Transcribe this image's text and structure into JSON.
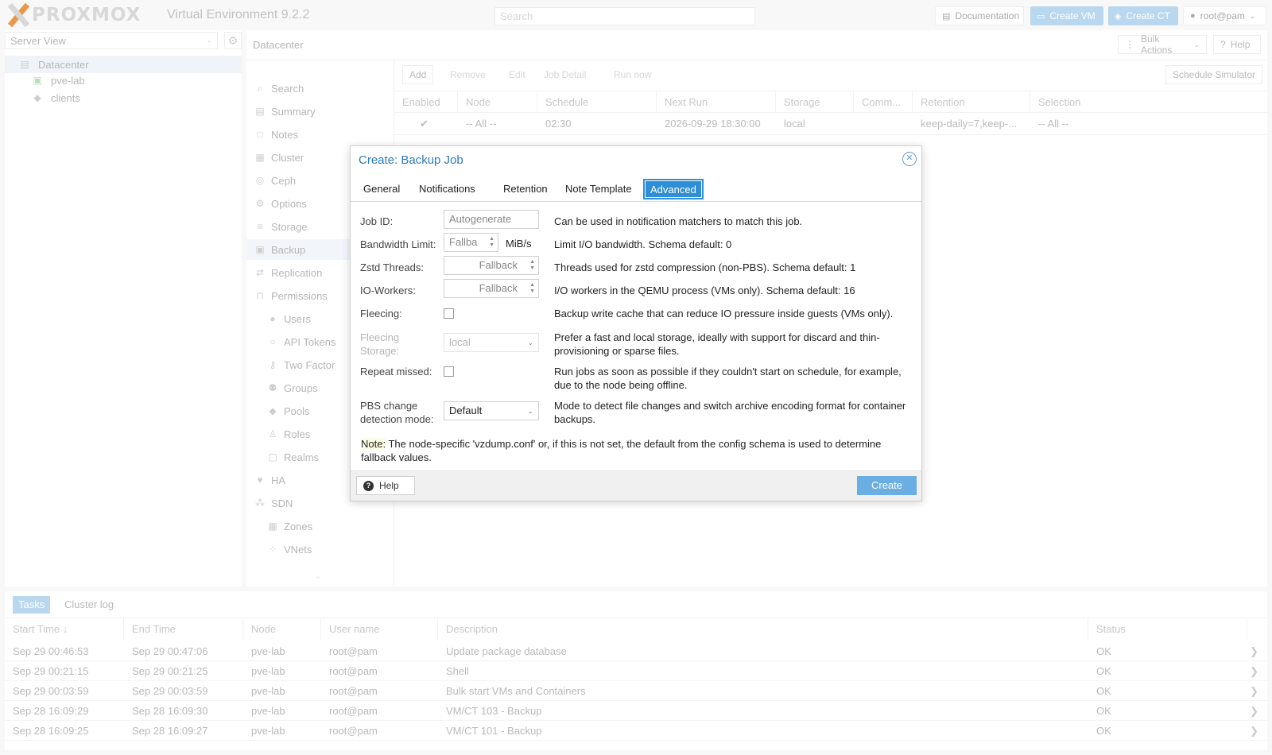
{
  "topbar": {
    "logo_text": "PROXMOX",
    "version": "Virtual Environment 9.2.2",
    "search_placeholder": "Search",
    "documentation": "Documentation",
    "create_vm": "Create VM",
    "create_ct": "Create CT",
    "user": "root@pam"
  },
  "tree": {
    "view": "Server View",
    "items": [
      {
        "label": "Datacenter",
        "icon": "server-rack-icon"
      },
      {
        "label": "pve-lab",
        "icon": "node-icon"
      },
      {
        "label": "clients",
        "icon": "tags-icon"
      }
    ]
  },
  "header": {
    "title": "Datacenter",
    "bulk_actions": "Bulk Actions",
    "help": "Help"
  },
  "nav": {
    "items": [
      {
        "label": "Search",
        "icon": "search-icon"
      },
      {
        "label": "Summary",
        "icon": "book-icon"
      },
      {
        "label": "Notes",
        "icon": "note-icon"
      },
      {
        "label": "Cluster",
        "icon": "cluster-icon"
      },
      {
        "label": "Ceph",
        "icon": "ceph-icon"
      },
      {
        "label": "Options",
        "icon": "gear-icon"
      },
      {
        "label": "Storage",
        "icon": "database-icon"
      },
      {
        "label": "Backup",
        "icon": "floppy-icon"
      },
      {
        "label": "Replication",
        "icon": "retweet-icon"
      },
      {
        "label": "Permissions",
        "icon": "unlock-icon"
      },
      {
        "label": "Users",
        "icon": "user-icon"
      },
      {
        "label": "API Tokens",
        "icon": "user-outline-icon"
      },
      {
        "label": "Two Factor",
        "icon": "key-icon"
      },
      {
        "label": "Groups",
        "icon": "users-icon"
      },
      {
        "label": "Pools",
        "icon": "tags-icon"
      },
      {
        "label": "Roles",
        "icon": "male-icon"
      },
      {
        "label": "Realms",
        "icon": "address-book-icon"
      },
      {
        "label": "HA",
        "icon": "heartbeat-icon"
      },
      {
        "label": "SDN",
        "icon": "sdn-icon"
      },
      {
        "label": "Zones",
        "icon": "grid-icon"
      },
      {
        "label": "VNets",
        "icon": "network-icon"
      }
    ]
  },
  "backup_toolbar": {
    "add": "Add",
    "remove": "Remove",
    "edit": "Edit",
    "job_detail": "Job Detail",
    "run_now": "Run now",
    "schedule_simulator": "Schedule Simulator"
  },
  "backup_grid": {
    "columns": [
      "Enabled",
      "Node",
      "Schedule",
      "Next Run",
      "Storage",
      "Comm...",
      "Retention",
      "Selection"
    ],
    "rows": [
      {
        "enabled": "✔",
        "node": "-- All --",
        "schedule": "02:30",
        "next_run": "2026-09-29 18:30:00",
        "storage": "local",
        "comment": "",
        "retention": "keep-daily=7,keep-...",
        "selection": "-- All --"
      }
    ]
  },
  "tasks": {
    "tab_tasks": "Tasks",
    "tab_cluster_log": "Cluster log",
    "columns": [
      "Start Time ↓",
      "End Time",
      "Node",
      "User name",
      "Description",
      "Status"
    ],
    "rows": [
      {
        "start": "Sep 29 00:46:53",
        "end": "Sep 29 00:47:06",
        "node": "pve-lab",
        "user": "root@pam",
        "desc": "Update package database",
        "status": "OK"
      },
      {
        "start": "Sep 29 00:21:15",
        "end": "Sep 29 00:21:25",
        "node": "pve-lab",
        "user": "root@pam",
        "desc": "Shell",
        "status": "OK"
      },
      {
        "start": "Sep 29 00:03:59",
        "end": "Sep 29 00:03:59",
        "node": "pve-lab",
        "user": "root@pam",
        "desc": "Bulk start VMs and Containers",
        "status": "OK"
      },
      {
        "start": "Sep 28 16:09:29",
        "end": "Sep 28 16:09:30",
        "node": "pve-lab",
        "user": "root@pam",
        "desc": "VM/CT 103 - Backup",
        "status": "OK"
      },
      {
        "start": "Sep 28 16:09:25",
        "end": "Sep 28 16:09:27",
        "node": "pve-lab",
        "user": "root@pam",
        "desc": "VM/CT 101 - Backup",
        "status": "OK"
      }
    ]
  },
  "modal": {
    "title": "Create: Backup Job",
    "tabs": [
      "General",
      "Notifications",
      "Retention",
      "Note Template",
      "Advanced"
    ],
    "active_tab": "Advanced",
    "fields": {
      "job_id": {
        "label": "Job ID:",
        "placeholder": "Autogenerate",
        "desc": "Can be used in notification matchers to match this job."
      },
      "bandwidth": {
        "label": "Bandwidth Limit:",
        "placeholder": "Fallba",
        "unit": "MiB/s",
        "desc": "Limit I/O bandwidth. Schema default: 0"
      },
      "zstd": {
        "label": "Zstd Threads:",
        "placeholder": "Fallback",
        "desc": "Threads used for zstd compression (non-PBS). Schema default: 1"
      },
      "io_workers": {
        "label": "IO-Workers:",
        "placeholder": "Fallback",
        "desc": "I/O workers in the QEMU process (VMs only). Schema default: 16"
      },
      "fleecing": {
        "label": "Fleecing:",
        "desc": "Backup write cache that can reduce IO pressure inside guests (VMs only)."
      },
      "fleecing_storage": {
        "label_1": "Fleecing",
        "label_2": "Storage:",
        "value": "local",
        "desc": "Prefer a fast and local storage, ideally with support for discard and thin-provisioning or sparse files."
      },
      "repeat_missed": {
        "label": "Repeat missed:",
        "desc": "Run jobs as soon as possible if they couldn't start on schedule, for example, due to the node being offline."
      },
      "pbs_mode": {
        "label_1": "PBS change",
        "label_2": "detection mode:",
        "value": "Default",
        "desc": "Mode to detect file changes and switch archive encoding format for container backups."
      }
    },
    "note_tag": "Note:",
    "note_text": " The node-specific 'vzdump.conf' or, if this is not set, the default from the config schema is used to determine fallback values.",
    "help": "Help",
    "create": "Create"
  }
}
